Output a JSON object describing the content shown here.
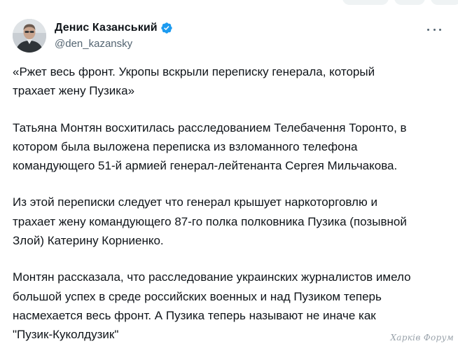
{
  "author": {
    "display_name": "Денис Казанський",
    "handle": "@den_kazansky",
    "verified": true,
    "verified_color": "#1d9bf0"
  },
  "icons": {
    "verified": "verified-badge-icon",
    "more": "more-options-icon"
  },
  "tweet": {
    "paragraphs": [
      "«Ржет весь фронт. Укропы вскрыли переписку генерала, который\nтрахает жену Пузика»",
      "Татьяна Монтян восхитилась расследованием Телебачення Торонто, в\nкотором была выложена переписка из взломанного телефона\nкомандующего 51-й армией генерал-лейтенанта Сергея Мильчакова.",
      "Из этой переписки следует что генерал крышует наркоторговлю и\nтрахает жену командующего 87-го полка полковника Пузика (позывной\nЗлой) Катерину Корниенко.",
      "Монтян рассказала, что расследование украинских журналистов имело\nбольшой успех в среде российских военных и над Пузиком теперь\nнасмехается весь фронт. А Пузика теперь называют не иначе как\n\"Пузик-Куколдузик\""
    ]
  },
  "watermark": "Харків Форум"
}
